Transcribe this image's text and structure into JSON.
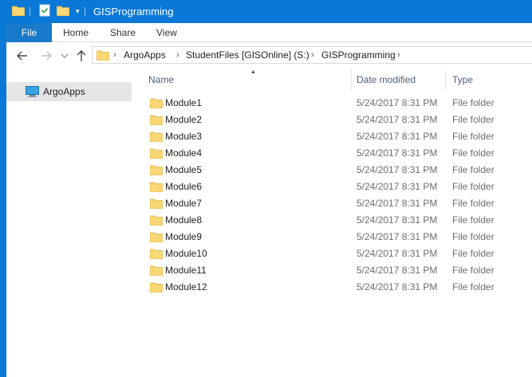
{
  "window": {
    "title": "GISProgramming"
  },
  "ribbon": {
    "tabs": [
      {
        "label": "File"
      },
      {
        "label": "Home"
      },
      {
        "label": "Share"
      },
      {
        "label": "View"
      }
    ]
  },
  "address": {
    "breadcrumb": [
      "ArgoApps",
      "StudentFiles [GISOnline] (S:)",
      "GISProgramming"
    ]
  },
  "navpane": {
    "items": [
      {
        "label": "ArgoApps",
        "icon": "computer-icon"
      }
    ]
  },
  "columns": {
    "name": "Name",
    "date": "Date modified",
    "type": "Type"
  },
  "files": [
    {
      "name": "Module1",
      "date": "5/24/2017 8:31 PM",
      "type": "File folder"
    },
    {
      "name": "Module2",
      "date": "5/24/2017 8:31 PM",
      "type": "File folder"
    },
    {
      "name": "Module3",
      "date": "5/24/2017 8:31 PM",
      "type": "File folder"
    },
    {
      "name": "Module4",
      "date": "5/24/2017 8:31 PM",
      "type": "File folder"
    },
    {
      "name": "Module5",
      "date": "5/24/2017 8:31 PM",
      "type": "File folder"
    },
    {
      "name": "Module6",
      "date": "5/24/2017 8:31 PM",
      "type": "File folder"
    },
    {
      "name": "Module7",
      "date": "5/24/2017 8:31 PM",
      "type": "File folder"
    },
    {
      "name": "Module8",
      "date": "5/24/2017 8:31 PM",
      "type": "File folder"
    },
    {
      "name": "Module9",
      "date": "5/24/2017 8:31 PM",
      "type": "File folder"
    },
    {
      "name": "Module10",
      "date": "5/24/2017 8:31 PM",
      "type": "File folder"
    },
    {
      "name": "Module11",
      "date": "5/24/2017 8:31 PM",
      "type": "File folder"
    },
    {
      "name": "Module12",
      "date": "5/24/2017 8:31 PM",
      "type": "File folder"
    }
  ],
  "colors": {
    "titlebar": "#0a78d7",
    "file_tab": "#1979ca",
    "folder_yellow": "#f8d775",
    "selected_nav": "#e5e5e5"
  }
}
